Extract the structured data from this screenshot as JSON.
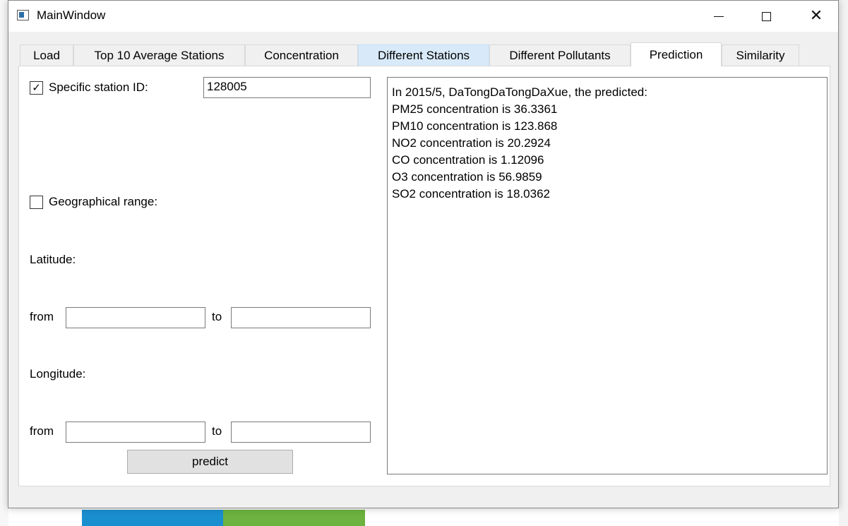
{
  "window": {
    "title": "MainWindow",
    "controls": [
      "minimize-icon",
      "maximize-icon",
      "close-icon"
    ]
  },
  "tabs": [
    {
      "label": "Load"
    },
    {
      "label": "Top 10 Average Stations"
    },
    {
      "label": "Concentration"
    },
    {
      "label": "Different Stations"
    },
    {
      "label": "Different Pollutants"
    },
    {
      "label": "Prediction"
    },
    {
      "label": "Similarity"
    }
  ],
  "active_tab": "Prediction",
  "form": {
    "station_checkbox_label": "Specific station ID:",
    "station_checked": true,
    "station_id_value": "128005",
    "geo_checkbox_label": "Geographical range:",
    "geo_checked": false,
    "latitude_label": "Latitude:",
    "longitude_label": "Longitude:",
    "from_label": "from",
    "to_label": "to",
    "lat_from_value": "",
    "lat_to_value": "",
    "lon_from_value": "",
    "lon_to_value": "",
    "predict_label": "predict"
  },
  "output": {
    "lines": [
      "In 2015/5, DaTongDaTongDaXue, the predicted:",
      "PM25 concentration is 36.3361",
      "PM10 concentration is 123.868",
      "NO2 concentration is 20.2924",
      "CO concentration is 1.12096",
      "O3 concentration is 56.9859",
      "SO2 concentration is 18.0362"
    ]
  },
  "colors": {
    "hover_tab": "#d8eaf9",
    "window_bg": "#f0f0f0",
    "panel_bg": "#ffffff"
  }
}
